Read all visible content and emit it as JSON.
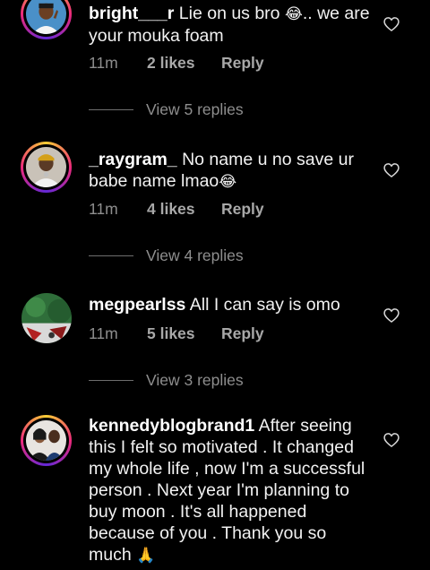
{
  "comments": [
    {
      "username": "bright___r",
      "text": "Lie on us bro",
      "text_tail": ".. we are your mouka foam",
      "emoji": "😂",
      "time": "11m",
      "likes": "2 likes",
      "reply_label": "Reply",
      "view_replies": "View 5 replies"
    },
    {
      "username": "_raygram_",
      "text": "No name u no save ur babe name lmao",
      "emoji": "😂",
      "time": "11m",
      "likes": "4 likes",
      "reply_label": "Reply",
      "view_replies": "View 4 replies"
    },
    {
      "username": "megpearlss",
      "text": "All I can say is omo",
      "time": "11m",
      "likes": "5 likes",
      "reply_label": "Reply",
      "view_replies": "View 3 replies"
    },
    {
      "username": "kennedyblogbrand1",
      "text": "After seeing this I felt so motivated . It changed my whole life , now I'm a successful person . Next year I'm planning to buy moon . It's all happened because of you . Thank you so much",
      "emoji": "🙏"
    }
  ],
  "icons": {
    "like": "heart-outline-icon"
  },
  "colors": {
    "background": "#000000",
    "meta_text": "#8e8e8e",
    "story_ring_start": "#f9ce34",
    "story_ring_mid": "#ee2a7b",
    "story_ring_end": "#6228d7"
  }
}
